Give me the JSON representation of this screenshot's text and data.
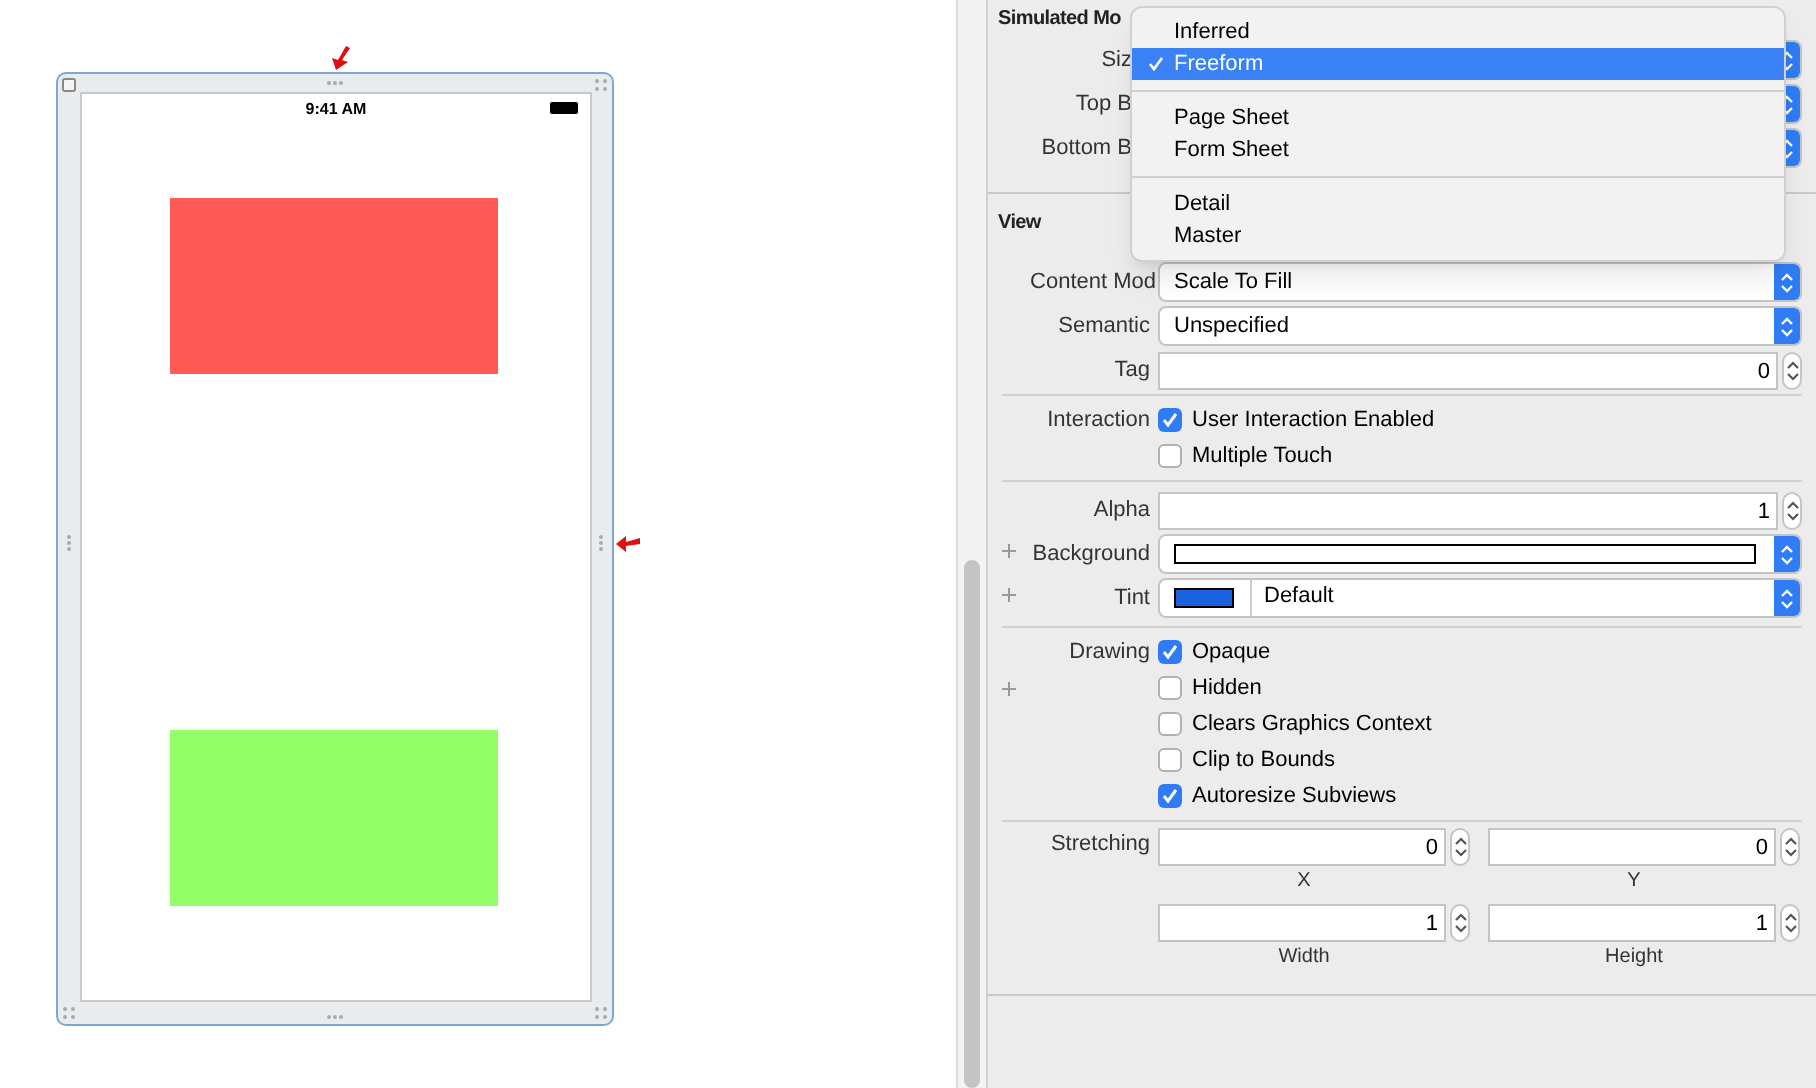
{
  "canvas": {
    "status_time": "9:41 AM",
    "views": [
      {
        "color": "#ff5a55"
      },
      {
        "color": "#93fe66"
      }
    ]
  },
  "inspector": {
    "sections": [
      {
        "title": "Simulated Mo",
        "groups": [
          [
            {
              "kind": "popup",
              "label": "Siz"
            },
            {
              "kind": "popup",
              "label": "Top B"
            },
            {
              "kind": "popup",
              "label": "Bottom B"
            }
          ]
        ]
      },
      {
        "title": "View",
        "groups": [
          [
            {
              "kind": "popup",
              "label": "Content Mod",
              "value": "Scale To Fill"
            },
            {
              "kind": "popup",
              "label": "Semantic",
              "value": "Unspecified"
            },
            {
              "kind": "number",
              "label": "Tag",
              "value": "0"
            }
          ],
          [
            {
              "kind": "check",
              "label": "Interaction",
              "text": "User Interaction Enabled",
              "checked": true
            },
            {
              "kind": "check",
              "text": "Multiple Touch",
              "checked": false
            }
          ],
          [
            {
              "kind": "number",
              "label": "Alpha",
              "value": "1"
            },
            {
              "kind": "color",
              "label": "Background",
              "plus": true,
              "color": "#ffffff"
            },
            {
              "kind": "color",
              "label": "Tint",
              "plus": true,
              "color": "#1a62e0",
              "value": "Default"
            }
          ],
          [
            {
              "kind": "check",
              "label": "Drawing",
              "text": "Opaque",
              "checked": true
            },
            {
              "kind": "check",
              "text": "Hidden",
              "checked": false,
              "plus": true
            },
            {
              "kind": "check",
              "text": "Clears Graphics Context",
              "checked": false
            },
            {
              "kind": "check",
              "text": "Clip to Bounds",
              "checked": false
            },
            {
              "kind": "check",
              "text": "Autoresize Subviews",
              "checked": true
            }
          ],
          [
            {
              "kind": "stretch",
              "label": "Stretching",
              "fields": [
                {
                  "value": "0",
                  "caption": "X"
                },
                {
                  "value": "0",
                  "caption": "Y"
                },
                {
                  "value": "1",
                  "caption": "Width"
                },
                {
                  "value": "1",
                  "caption": "Height"
                }
              ]
            }
          ]
        ]
      }
    ]
  },
  "menu": {
    "groups": [
      [
        {
          "label": "Inferred",
          "selected": false
        },
        {
          "label": "Freeform",
          "selected": true
        }
      ],
      [
        {
          "label": "Page Sheet",
          "selected": false
        },
        {
          "label": "Form Sheet",
          "selected": false
        }
      ],
      [
        {
          "label": "Detail",
          "selected": false
        },
        {
          "label": "Master",
          "selected": false
        }
      ]
    ]
  }
}
